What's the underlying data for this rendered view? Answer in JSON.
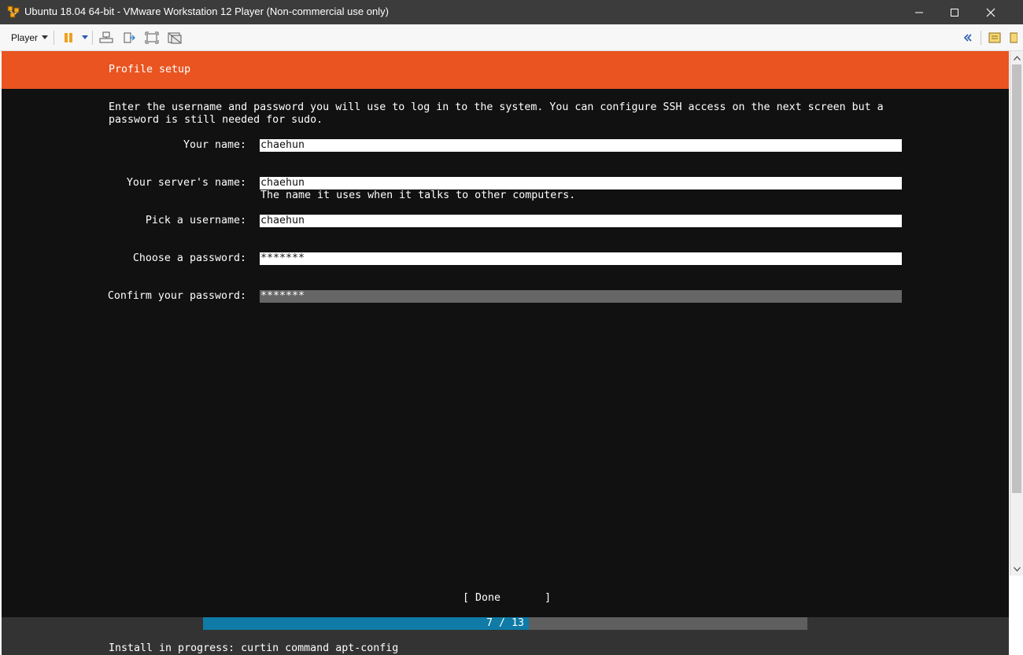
{
  "window": {
    "title": "Ubuntu 18.04 64-bit - VMware Workstation 12 Player (Non-commercial use only)"
  },
  "toolbar": {
    "player_label": "Player",
    "icons": [
      "pause-icon",
      "send-ctrl-alt-del-icon",
      "removable-devices-icon",
      "full-screen-icon",
      "unity-icon",
      "collapse-icon",
      "vm-settings-icon"
    ]
  },
  "installer": {
    "header": "Profile setup",
    "intro_line1": "Enter the username and password you will use to log in to the system. You can configure SSH access on the next screen but a",
    "intro_line2": "password is still needed for sudo.",
    "fields": [
      {
        "label": "Your name:",
        "value": "chaehun"
      },
      {
        "label": "Your server's name:",
        "value": "chaehun",
        "help": "The name it uses when it talks to other computers."
      },
      {
        "label": "Pick a username:",
        "value": "chaehun"
      },
      {
        "label": "Choose a password:",
        "value": "*******"
      },
      {
        "label": "Confirm your password:",
        "value": "*******"
      }
    ],
    "done_button": "[ Done       ]",
    "progress": {
      "text": "7 / 13",
      "current": 7,
      "total": 13
    },
    "status": "Install in progress: curtin command apt-config"
  },
  "colors": {
    "ubuntu_orange": "#e95420",
    "terminal_bg": "#111111",
    "progress_fill": "#0f7ba6",
    "progress_track": "#5f5f5f"
  }
}
